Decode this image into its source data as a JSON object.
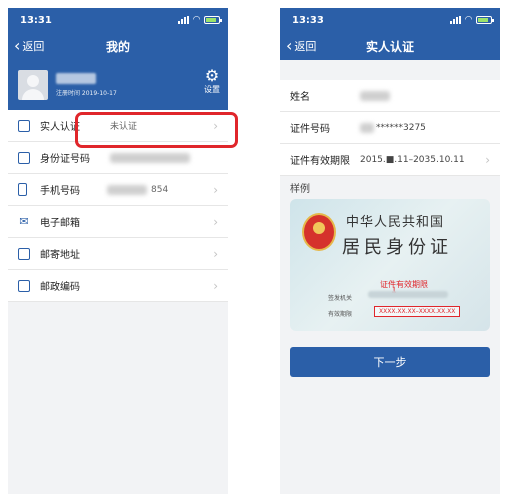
{
  "left": {
    "status_time": "13:31",
    "back_label": "返回",
    "title": "我的",
    "profile_date": "注册时间 2019-10-17",
    "settings_label": "设置",
    "menu": [
      {
        "label": "实人认证",
        "value": "未认证"
      },
      {
        "label": "身份证号码",
        "value": ""
      },
      {
        "label": "手机号码",
        "value": "854"
      },
      {
        "label": "电子邮箱",
        "value": ""
      },
      {
        "label": "邮寄地址",
        "value": ""
      },
      {
        "label": "邮政编码",
        "value": ""
      }
    ]
  },
  "right": {
    "status_time": "13:33",
    "back_label": "返回",
    "title": "实人认证",
    "fields": [
      {
        "label": "姓名",
        "value": ""
      },
      {
        "label": "证件号码",
        "value": "******3275"
      },
      {
        "label": "证件有效期限",
        "value": "2015.■.11–2035.10.11"
      }
    ],
    "sample_label": "样例",
    "card": {
      "line1": "中华人民共和国",
      "line2": "居民身份证",
      "validity_hint": "证件有效期限",
      "issuer_key": "签发机关",
      "validity_key": "有效期限",
      "validity_value": "XXXX.XX.XX–XXXX.XX.XX"
    },
    "next_label": "下一步"
  },
  "colors": {
    "primary": "#2b5fa8",
    "highlight": "#e0262b"
  }
}
